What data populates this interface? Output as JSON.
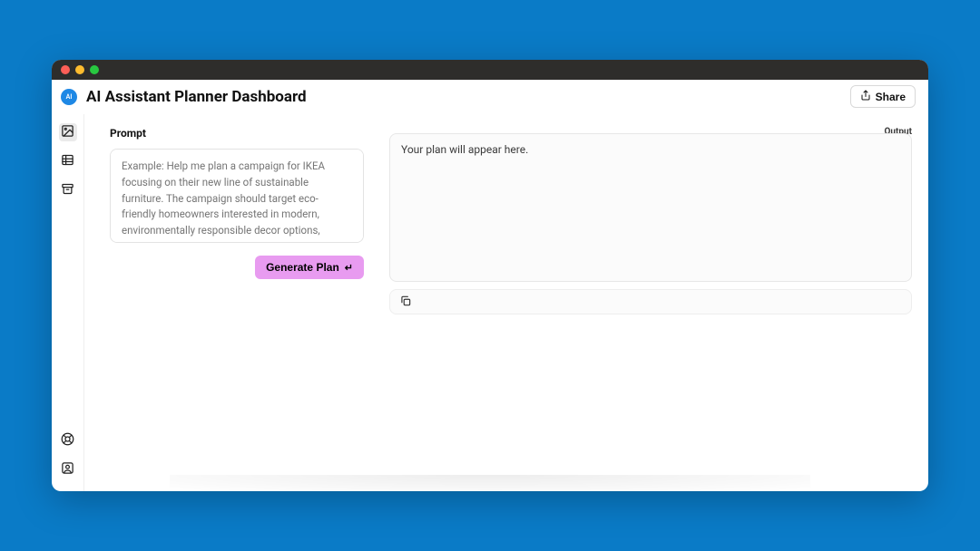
{
  "header": {
    "title": "AI Assistant Planner Dashboard",
    "share_label": "Share"
  },
  "sidebar": {
    "top_items": [
      "image",
      "table",
      "archive"
    ],
    "bottom_items": [
      "help",
      "profile"
    ]
  },
  "prompt": {
    "label": "Prompt",
    "placeholder": "Example: Help me plan a campaign for IKEA focusing on their new line of sustainable furniture. The campaign should target eco-friendly homeowners interested in modern, environmentally responsible decor options, predominantly in Europe.",
    "value": ""
  },
  "generate": {
    "label": "Generate Plan"
  },
  "output": {
    "label": "Output",
    "placeholder": "Your plan will appear here."
  },
  "colors": {
    "accent_button": "#e89bf0",
    "brand_badge": "#1e88e5",
    "page_bg": "#0a7bc7"
  }
}
